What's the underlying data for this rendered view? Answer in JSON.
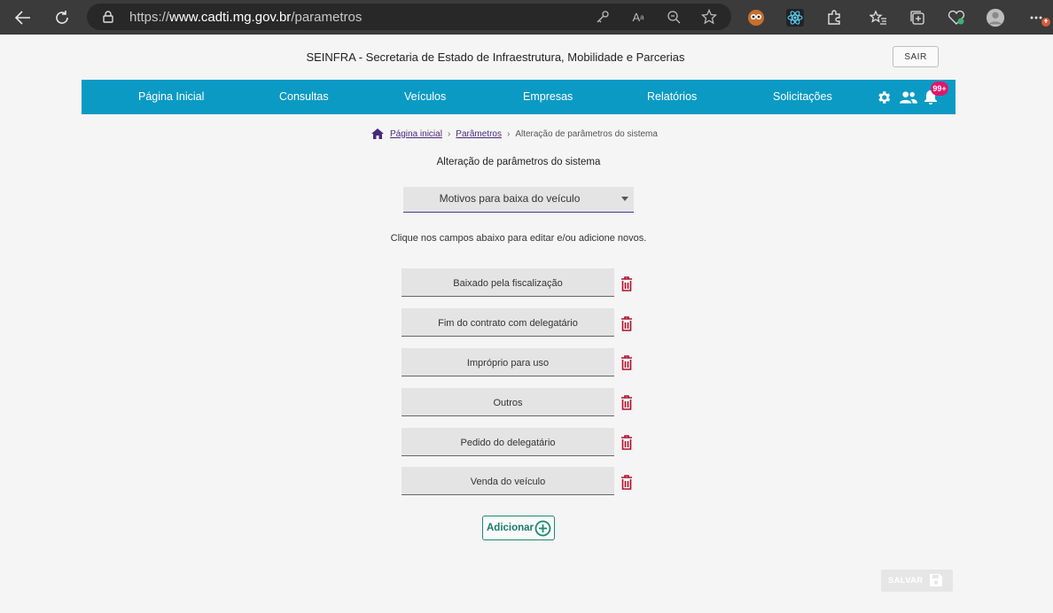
{
  "browser": {
    "url_prefix": "https://",
    "url_host": "www.cadti.mg.gov.br",
    "url_path": "/parametros"
  },
  "header": {
    "title": "SEINFRA - Secretaria de Estado de Infraestrutura, Mobilidade e Parcerias",
    "logout_label": "SAIR"
  },
  "nav": {
    "items": [
      "Página Inicial",
      "Consultas",
      "Veículos",
      "Empresas",
      "Relatórios",
      "Solicitações"
    ],
    "notification_count": "99+"
  },
  "breadcrumb": {
    "home": "Página inicial",
    "params": "Parâmetros",
    "current": "Alteração de parâmetros do sistema",
    "separator": "›"
  },
  "main": {
    "title": "Alteração de parâmetros do sistema",
    "select_value": "Motivos para baixa do veículo",
    "hint": "Clique nos campos abaixo para editar e/ou adicione novos.",
    "fields": [
      "Baixado pela fiscalização",
      "Fim do contrato com delegatário",
      "Impróprio para uso",
      "Outros",
      "Pedido do delegatário",
      "Venda do veículo"
    ],
    "add_label": "Adicionar",
    "save_label": "SALVAR"
  },
  "colors": {
    "navbar": "#0b9ac4",
    "trash": "#b0102a",
    "add": "#1a8a72",
    "badge": "#e2156b"
  }
}
